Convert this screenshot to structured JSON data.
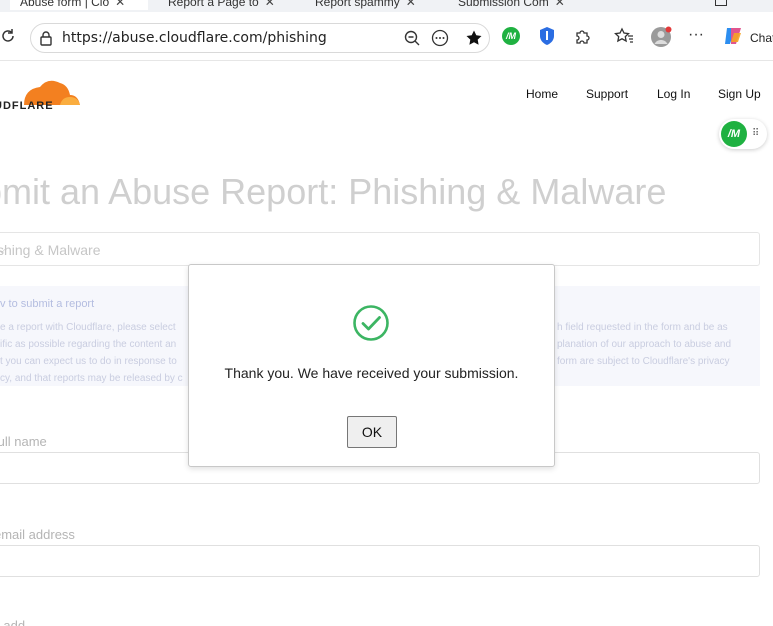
{
  "browser": {
    "tabs": [
      {
        "label": "Abuse form | Clo"
      },
      {
        "label": "Report a Page to"
      },
      {
        "label": "Report spammy"
      },
      {
        "label": "Submission Com"
      }
    ],
    "url": "https://abuse.cloudflare.com/phishing",
    "chat_label": "Chat"
  },
  "site": {
    "logo_text": "UDFLARE",
    "nav": {
      "home": "Home",
      "support": "Support",
      "login": "Log In",
      "signup": "Sign Up"
    },
    "ext_badge": "/M"
  },
  "form": {
    "heading": "bmit an Abuse Report: Phishing & Malware",
    "select_value": "shing & Malware",
    "info_title": "v to submit a report",
    "info_lines": [
      "e a report with Cloudflare, please select",
      "ific as possible regarding the content an",
      "t you can expect us to do in response to",
      "cy, and that reports may be released by c"
    ],
    "info_lines_right": [
      "h field requested in the form and be as",
      "planation of our approach to abuse and",
      "form are subject to Cloudflare's privacy"
    ],
    "name_label": "full name",
    "email_label": "email address",
    "next_label": "il add"
  },
  "dialog": {
    "message": "Thank you. We have received your submission.",
    "ok_label": "OK",
    "check_color": "#3cb563"
  },
  "colors": {
    "cloudflare_orange": "#f38020",
    "accent_green": "#1fb141"
  }
}
